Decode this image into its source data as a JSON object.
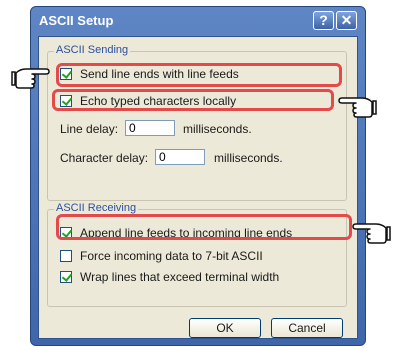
{
  "window": {
    "title": "ASCII Setup",
    "help_glyph": "?",
    "close_glyph": "✕"
  },
  "ascii_sending": {
    "group_title": "ASCII Sending",
    "checkboxes": [
      {
        "label": "Send line ends with line feeds",
        "checked": true
      },
      {
        "label": "Echo typed characters locally",
        "checked": true
      }
    ],
    "line_delay": {
      "label": "Line delay:",
      "value": "0",
      "unit": "milliseconds."
    },
    "character_delay": {
      "label": "Character delay:",
      "value": "0",
      "unit": "milliseconds."
    }
  },
  "ascii_receiving": {
    "group_title": "ASCII Receiving",
    "checkboxes": [
      {
        "label": "Append line feeds to incoming line ends",
        "checked": true
      },
      {
        "label": "Force incoming data to 7-bit ASCII",
        "checked": false
      },
      {
        "label": "Wrap lines that exceed terminal width",
        "checked": true
      }
    ]
  },
  "buttons": {
    "ok_label": "OK",
    "cancel_label": "Cancel"
  },
  "annotations": {
    "highlight_color": "#e34a4a",
    "pointer_icon": "pointing-hand-icon"
  }
}
